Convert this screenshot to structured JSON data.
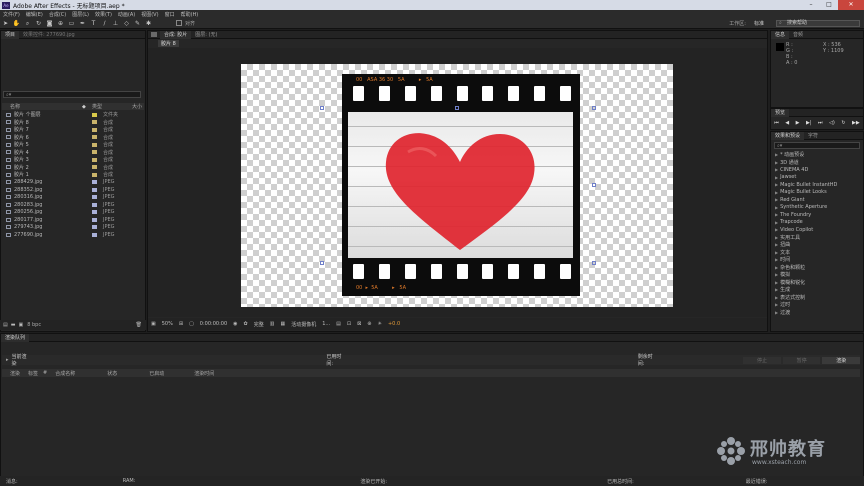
{
  "app": {
    "title": "Adobe After Effects - 无标题项目.aep *",
    "logo": "Ae"
  },
  "window_controls": [
    "–",
    "□",
    "✕"
  ],
  "menu": [
    "文件(F)",
    "编辑(E)",
    "合成(C)",
    "图层(L)",
    "效果(T)",
    "动画(A)",
    "视图(V)",
    "窗口",
    "帮助(H)"
  ],
  "toolbar": {
    "icons": [
      "selection-icon",
      "hand-icon",
      "zoom-icon",
      "rotate-icon",
      "camera-icon",
      "pan-behind-icon",
      "rect-mask-icon",
      "pen-icon",
      "text-icon",
      "brush-icon",
      "clone-icon",
      "eraser-icon",
      "roto-icon",
      "puppet-icon"
    ],
    "align_label": "对齐",
    "workspace_label": "工作区:",
    "workspace_value": "标准",
    "search_help": "搜索帮助"
  },
  "project": {
    "tab": "项目",
    "footage_tab": "效果控件: 277690.jpg",
    "columns": [
      "名称",
      "类型",
      "大小"
    ],
    "items": [
      {
        "name": "胶片 个图层",
        "type": "文件夹",
        "color": "#d8c94a",
        "folder": true
      },
      {
        "name": "胶片 8",
        "type": "合成",
        "color": "#c9b36a"
      },
      {
        "name": "胶片 7",
        "type": "合成",
        "color": "#c9b36a"
      },
      {
        "name": "胶片 6",
        "type": "合成",
        "color": "#c9b36a"
      },
      {
        "name": "胶片 5",
        "type": "合成",
        "color": "#c9b36a"
      },
      {
        "name": "胶片 4",
        "type": "合成",
        "color": "#c9b36a"
      },
      {
        "name": "胶片 3",
        "type": "合成",
        "color": "#c9b36a"
      },
      {
        "name": "胶片 2",
        "type": "合成",
        "color": "#c9b36a"
      },
      {
        "name": "胶片 1",
        "type": "合成",
        "color": "#c9b36a"
      },
      {
        "name": "288429.jpg",
        "type": "JPEG",
        "color": "#a9b0d8"
      },
      {
        "name": "288352.jpg",
        "type": "JPEG",
        "color": "#a9b0d8"
      },
      {
        "name": "280316.jpg",
        "type": "JPEG",
        "color": "#a9b0d8"
      },
      {
        "name": "280283.jpg",
        "type": "JPEG",
        "color": "#a9b0d8"
      },
      {
        "name": "280256.jpg",
        "type": "JPEG",
        "color": "#a9b0d8"
      },
      {
        "name": "280177.jpg",
        "type": "JPEG",
        "color": "#a9b0d8"
      },
      {
        "name": "279743.jpg",
        "type": "JPEG",
        "color": "#a9b0d8"
      },
      {
        "name": "277690.jpg",
        "type": "JPEG",
        "color": "#a9b0d8"
      }
    ],
    "bpc": "8 bpc"
  },
  "composition": {
    "tab": "合成: 胶片",
    "layer_tab": "图层: (无)",
    "sub_tab": "胶片 8",
    "footer": {
      "zoom": "50%",
      "timecode": "0:00:00:00",
      "resolution": "完整",
      "camera": "活动摄像机",
      "views": "1...",
      "exposure": "+0.0"
    },
    "film_top_text": "00   ASA 36 30   5A         ▸   5A",
    "film_bottom_text": "00  ▸  5A         ▸   5A"
  },
  "info": {
    "tab": "信息",
    "audio_tab": "音频",
    "R": "R :",
    "G": "G :",
    "B": "B :",
    "A": "A : 0",
    "X": "X : 536",
    "Y": "Y : 1109"
  },
  "preview": {
    "tab": "预览"
  },
  "effects": {
    "tab": "效果和预设",
    "char_tab": "字符",
    "items": [
      "* 动画预设",
      "3D 通道",
      "CINEMA 4D",
      "Jawset",
      "Magic Bullet InstantHD",
      "Magic Bullet Looks",
      "Red Giant",
      "Synthetic Aperture",
      "The Foundry",
      "Trapcode",
      "Video Copilot",
      "实用工具",
      "扭曲",
      "文本",
      "时间",
      "杂色和颗粒",
      "模拟",
      "模糊和锐化",
      "生成",
      "表达式控制",
      "过时",
      "过渡"
    ]
  },
  "render_queue": {
    "tab": "渲染队列",
    "current_render": "当前渲染",
    "elapsed": "已用时间:",
    "remaining": "剩余时间:",
    "stop": "停止",
    "pause": "暂停",
    "render": "渲染",
    "columns": [
      "渲染",
      "标签",
      "#",
      "合成名称",
      "状态",
      "已启动",
      "渲染时间"
    ]
  },
  "status_bar": {
    "message": "消息:",
    "ram": "RAM:",
    "renders_started": "渲染已开始:",
    "total_time": "已用总时间:",
    "recent_error": "最近错误:"
  },
  "watermark": {
    "brand": "邢帅教育",
    "url": "www.xsteach.com",
    "color": "#9aa0a8"
  }
}
